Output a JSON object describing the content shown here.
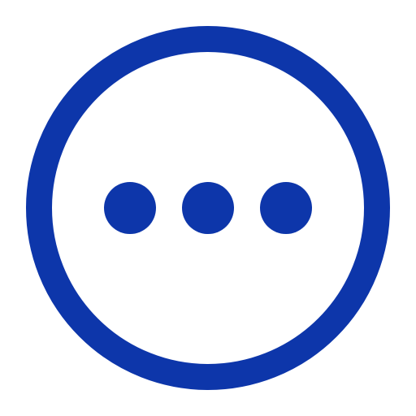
{
  "icon": {
    "name": "more-options-icon",
    "description_glyph": "circle-with-three-dots",
    "color": "#0D36AA",
    "background": "#FFFFFF",
    "dot_count": 3
  }
}
